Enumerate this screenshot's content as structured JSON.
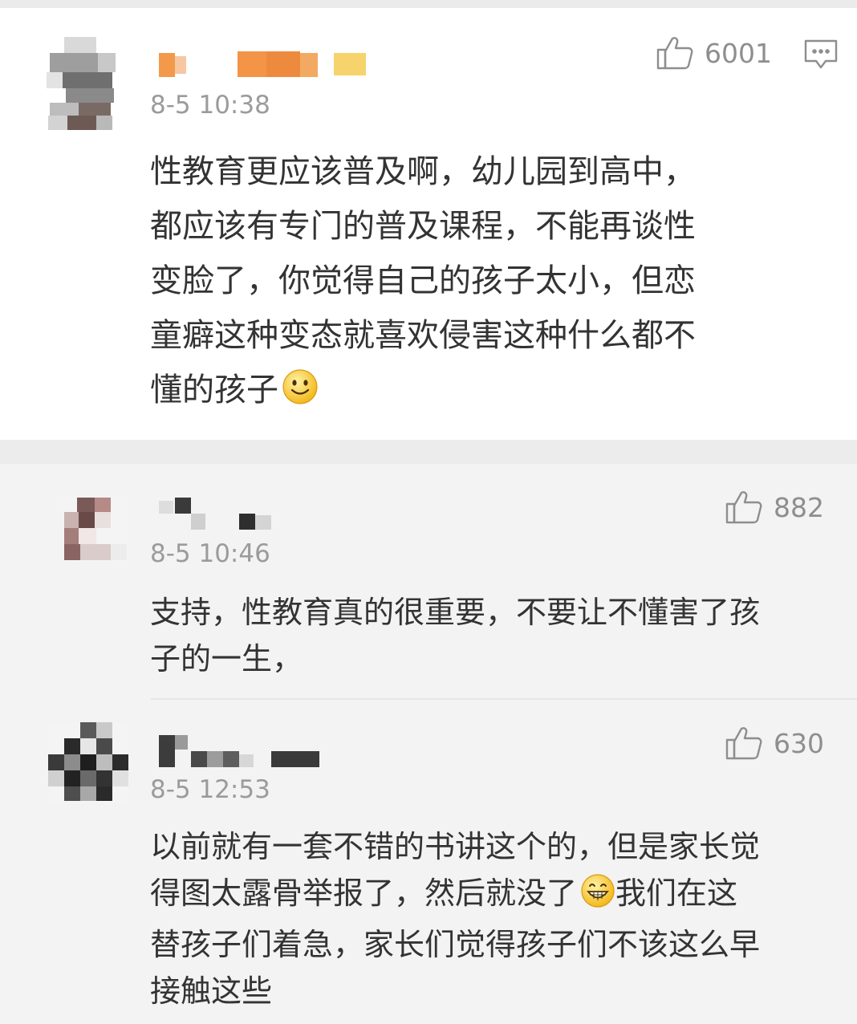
{
  "comments": [
    {
      "timestamp": "8-5 10:38",
      "likes": "6001",
      "text_lines": [
        "性教育更应该普及啊，幼儿园到高中，",
        "都应该有专门的普及课程，不能再谈性",
        "变脸了，你觉得自己的孩子太小，但恋",
        "童癖这种变态就喜欢侵害这种什么都不",
        "懂的孩子"
      ],
      "emoji": "smile-emoji"
    },
    {
      "timestamp": "8-5 10:46",
      "likes": "882",
      "text_lines": [
        "支持，性教育真的很重要，不要让不懂害了孩",
        "子的一生，"
      ]
    },
    {
      "timestamp": "8-5 12:53",
      "likes": "630",
      "text_lines": [
        "以前就有一套不错的书讲这个的，但是家长觉",
        "得图太露骨举报了，然后就没了",
        "我们在这",
        "替孩子们着急，家长们觉得孩子们不该这么早",
        "接触这些"
      ],
      "emoji": "grin-emoji"
    }
  ],
  "icons": {
    "like": "thumbs-up-icon",
    "reply": "comment-icon"
  },
  "colors": {
    "text": "#333333",
    "meta": "#9b9b9b",
    "card": "#ffffff",
    "reply_bg": "#f3f3f3"
  }
}
